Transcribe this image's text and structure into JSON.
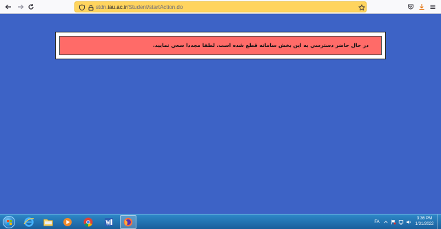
{
  "browser": {
    "url_prefix": "stdn.",
    "url_host": "iau.ac.ir",
    "url_path": "/Student/startAction.do"
  },
  "message": {
    "text": "در حال حاضر دسترسي به اين بخش سامانه قطع شده است. لطفا مجددا سعي نماييد."
  },
  "taskbar": {
    "language": "FA",
    "time": "3:36 PM",
    "date": "1/31/2022"
  },
  "colors": {
    "page_background": "#3d63c6",
    "message_background": "#ff6b68",
    "urlbar_highlight": "#ffd45e"
  }
}
